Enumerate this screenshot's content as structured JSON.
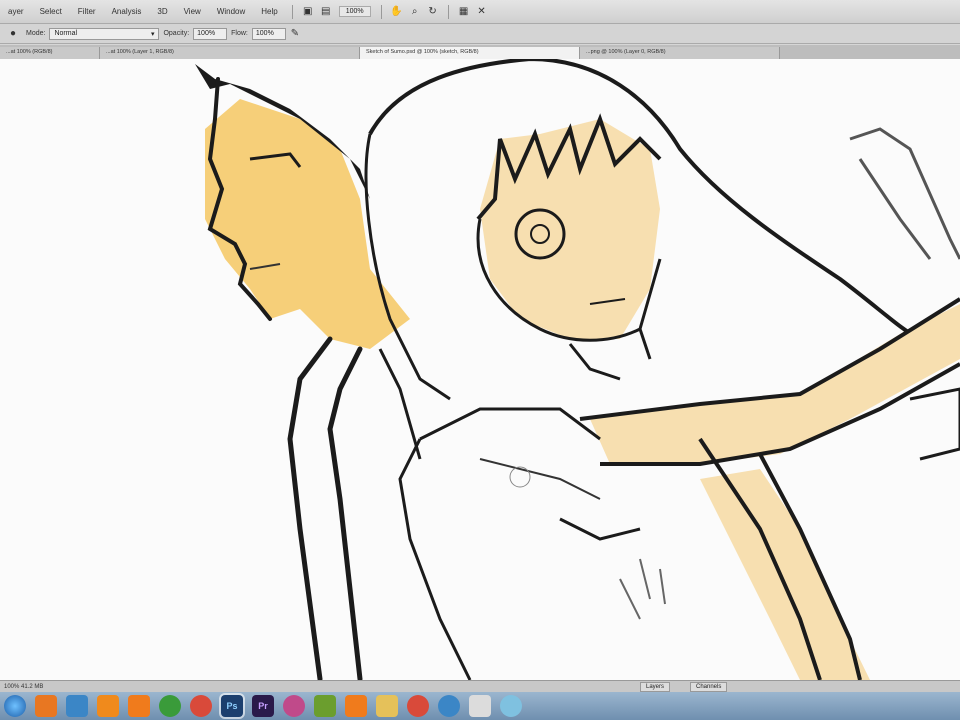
{
  "menubar": {
    "items": [
      "ayer",
      "Select",
      "Filter",
      "Analysis",
      "3D",
      "View",
      "Window",
      "Help"
    ],
    "zoom": "100%"
  },
  "options": {
    "mode_label": "Mode:",
    "mode_value": "Normal",
    "opacity_label": "Opacity:",
    "opacity_value": "100%",
    "flow_label": "Flow:",
    "flow_value": "100%"
  },
  "tabs": [
    {
      "label": "...at 100% (RGB/8)",
      "active": false
    },
    {
      "label": "...at 100% (Layer 1, RGB/8)",
      "active": false
    },
    {
      "label": "Sketch of Sumo.psd @ 100% (sketch, RGB/8)",
      "active": true
    },
    {
      "label": "...png @ 100% (Layer 0, RGB/8)",
      "active": false
    }
  ],
  "status": {
    "zoom_text": "100% 41.2 MB",
    "panel_tabs": [
      "Layers",
      "Channels"
    ]
  },
  "colors": {
    "skin_tan": "#f6cf79",
    "skin_light": "#f7dfb0",
    "line": "#1b1b1b",
    "canvas": "#fbfbfb"
  },
  "taskbar": {
    "icons": [
      "windows-orb",
      "firefox",
      "file-explorer",
      "media-player",
      "vlc",
      "utorrent",
      "chrome",
      "photoshop",
      "premiere",
      "music",
      "paint",
      "vlc-2",
      "folder",
      "chrome-2",
      "ie",
      "skype",
      "chat"
    ]
  }
}
